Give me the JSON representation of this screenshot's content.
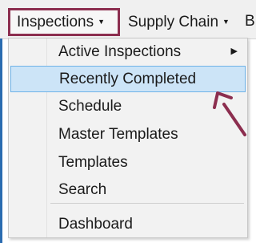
{
  "menubar": {
    "items": [
      {
        "label": "Inspections",
        "has_dropdown": true,
        "active": true
      },
      {
        "label": "Supply Chain",
        "has_dropdown": true,
        "active": false
      },
      {
        "label": "B",
        "has_dropdown": false,
        "active": false
      }
    ],
    "caret_glyph": "▼"
  },
  "dropdown": {
    "items": [
      {
        "label": "Active Inspections",
        "has_submenu": true
      },
      {
        "label": "Recently Completed",
        "highlighted": true
      },
      {
        "label": "Schedule"
      },
      {
        "label": "Master Templates"
      },
      {
        "label": "Templates"
      },
      {
        "label": "Search"
      },
      {
        "label": "Dashboard"
      }
    ],
    "submenu_glyph": "▶"
  },
  "colors": {
    "highlight_box": "#8c2e4f",
    "annotation_arrow": "#8c2e4f",
    "selected_item_bg": "#cce4f7",
    "selected_item_border": "#6fb3e8"
  },
  "icons": {
    "annotation": "arrow-pointer-icon"
  }
}
